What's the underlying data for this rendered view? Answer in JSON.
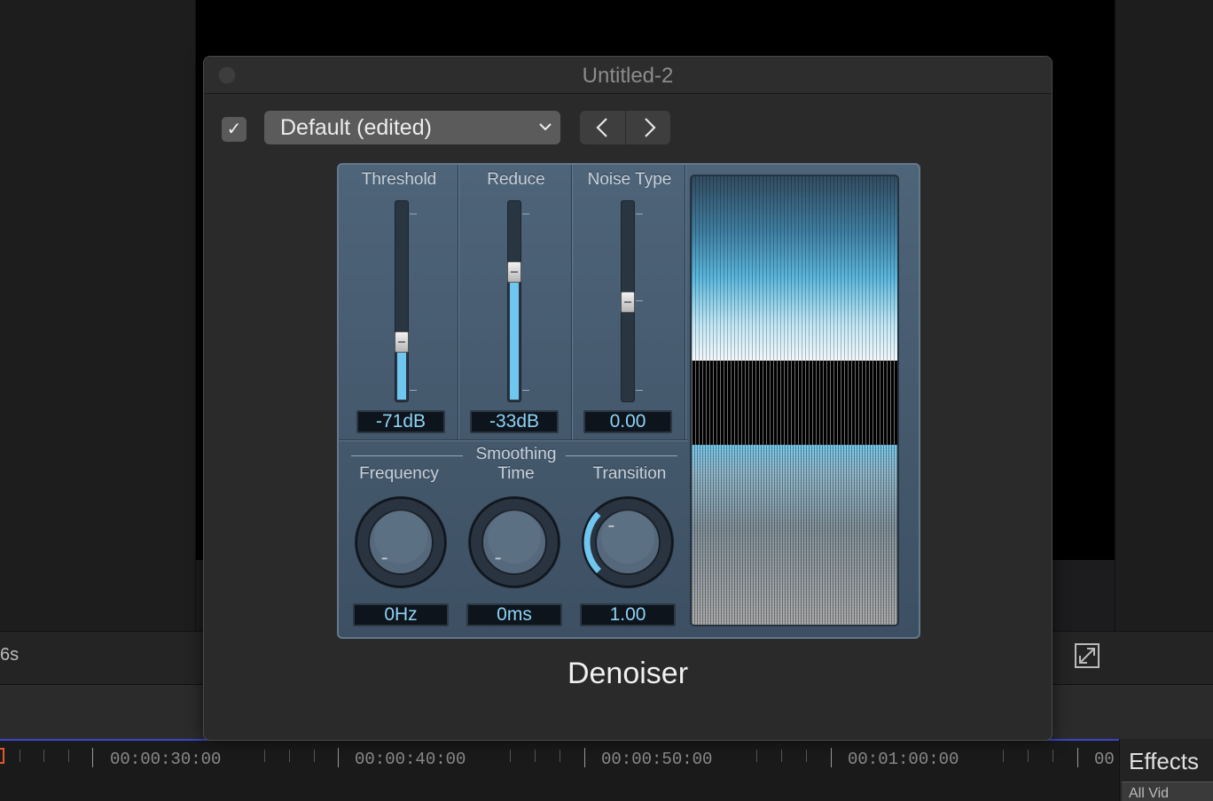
{
  "background": {
    "duration_label": "6s",
    "ruler_labels": [
      "00:00:30:00",
      "00:00:40:00",
      "00:00:50:00",
      "00:01:00:00",
      "00"
    ],
    "effects_panel_title": "Effects",
    "effects_panel_subtitle": "All Vid"
  },
  "window": {
    "title": "Untitled-2",
    "enabled_check": "✓",
    "preset_value": "Default (edited)"
  },
  "plugin": {
    "name": "Denoiser",
    "sliders": [
      {
        "label": "Threshold",
        "value_text": "-71dB",
        "level": 0.3
      },
      {
        "label": "Reduce",
        "value_text": "-33dB",
        "level": 0.65
      },
      {
        "label": "Noise Type",
        "value_text": "0.00",
        "level": 0.5
      }
    ],
    "smoothing_group_label": "Smoothing",
    "knobs": [
      {
        "label": "Frequency",
        "value_text": "0Hz",
        "level": 0.0
      },
      {
        "label": "Time",
        "value_text": "0ms",
        "level": 0.0
      },
      {
        "label": "Transition",
        "value_text": "1.00",
        "level": 0.33
      }
    ]
  },
  "colors": {
    "accent": "#6fc6ef",
    "panel": "#4e6479",
    "value_text": "#8ed2f4"
  }
}
